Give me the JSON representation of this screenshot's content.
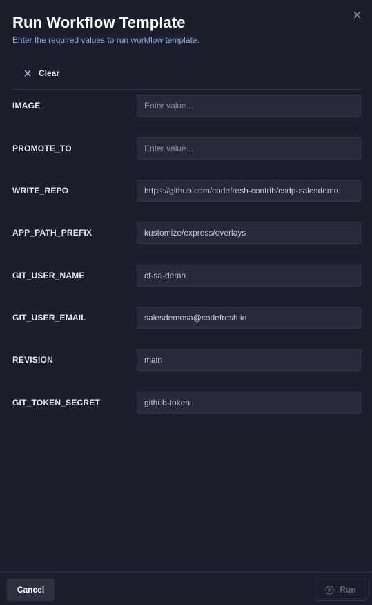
{
  "dialog": {
    "title": "Run Workflow Template",
    "subtitle": "Enter the required values to run workflow template."
  },
  "toolbar": {
    "clear_label": "Clear",
    "clear_icon": "close-icon"
  },
  "fields": [
    {
      "label": "IMAGE",
      "value": "",
      "placeholder": "Enter value..."
    },
    {
      "label": "PROMOTE_TO",
      "value": "",
      "placeholder": "Enter value..."
    },
    {
      "label": "WRITE_REPO",
      "value": "https://github.com/codefresh-contrib/csdp-salesdemo",
      "placeholder": ""
    },
    {
      "label": "APP_PATH_PREFIX",
      "value": "kustomize/express/overlays",
      "placeholder": ""
    },
    {
      "label": "GIT_USER_NAME",
      "value": "cf-sa-demo",
      "placeholder": ""
    },
    {
      "label": "GIT_USER_EMAIL",
      "value": "salesdemosa@codefresh.io",
      "placeholder": ""
    },
    {
      "label": "REVISION",
      "value": "main",
      "placeholder": ""
    },
    {
      "label": "GIT_TOKEN_SECRET",
      "value": "github-token",
      "placeholder": ""
    }
  ],
  "footer": {
    "cancel_label": "Cancel",
    "run_label": "Run",
    "run_icon": "play-circle-icon"
  },
  "colors": {
    "background": "#1b1e2b",
    "input_bg": "#272a3a",
    "subtitle": "#8ea4e8"
  }
}
